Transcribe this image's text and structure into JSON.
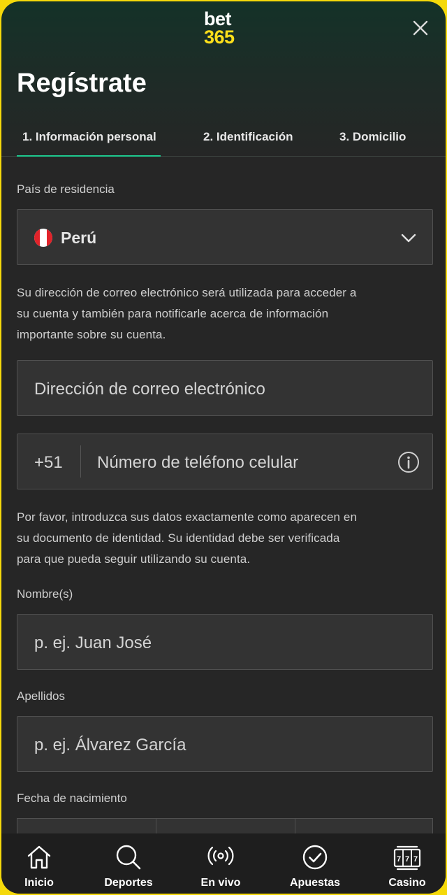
{
  "header": {
    "logo_line1": "bet",
    "logo_line2": "365",
    "close_icon": "close-icon"
  },
  "page_title": "Regístrate",
  "steps": [
    {
      "label": "1.  Información personal",
      "active": true
    },
    {
      "label": "2.  Identificación",
      "active": false
    },
    {
      "label": "3.  Domicilio",
      "active": false
    }
  ],
  "country": {
    "label": "País de residencia",
    "value": "Perú",
    "flag_icon": "peru-flag-icon"
  },
  "email": {
    "info_lines": [
      "Su dirección de correo electrónico será utilizada para acceder a",
      "su cuenta y también para notificarle acerca de información",
      "importante sobre su cuenta."
    ],
    "placeholder": "Dirección de correo electrónico"
  },
  "phone": {
    "prefix": "+51",
    "placeholder": "Número de teléfono celular"
  },
  "identity_note_lines": [
    "Por favor, introduzca sus datos exactamente como aparecen en",
    "su documento de identidad. Su identidad debe ser verificada",
    "para que pueda seguir utilizando su cuenta."
  ],
  "first_name": {
    "label": "Nombre(s)",
    "placeholder": "p. ej. Juan José"
  },
  "last_name": {
    "label": "Apellidos",
    "placeholder": "p. ej. Álvarez García"
  },
  "birth_date": {
    "label": "Fecha de nacimiento"
  },
  "tabbar": [
    {
      "label": "Inicio",
      "icon": "home-icon"
    },
    {
      "label": "Deportes",
      "icon": "search-icon"
    },
    {
      "label": "En vivo",
      "icon": "live-broadcast-icon"
    },
    {
      "label": "Apuestas",
      "icon": "check-circle-icon"
    },
    {
      "label": "Casino",
      "icon": "slot-machine-icon"
    }
  ],
  "colors": {
    "accent": "#1ec98e",
    "brand_yellow": "#ffdf1b",
    "background": "#262626",
    "field": "#333333"
  }
}
